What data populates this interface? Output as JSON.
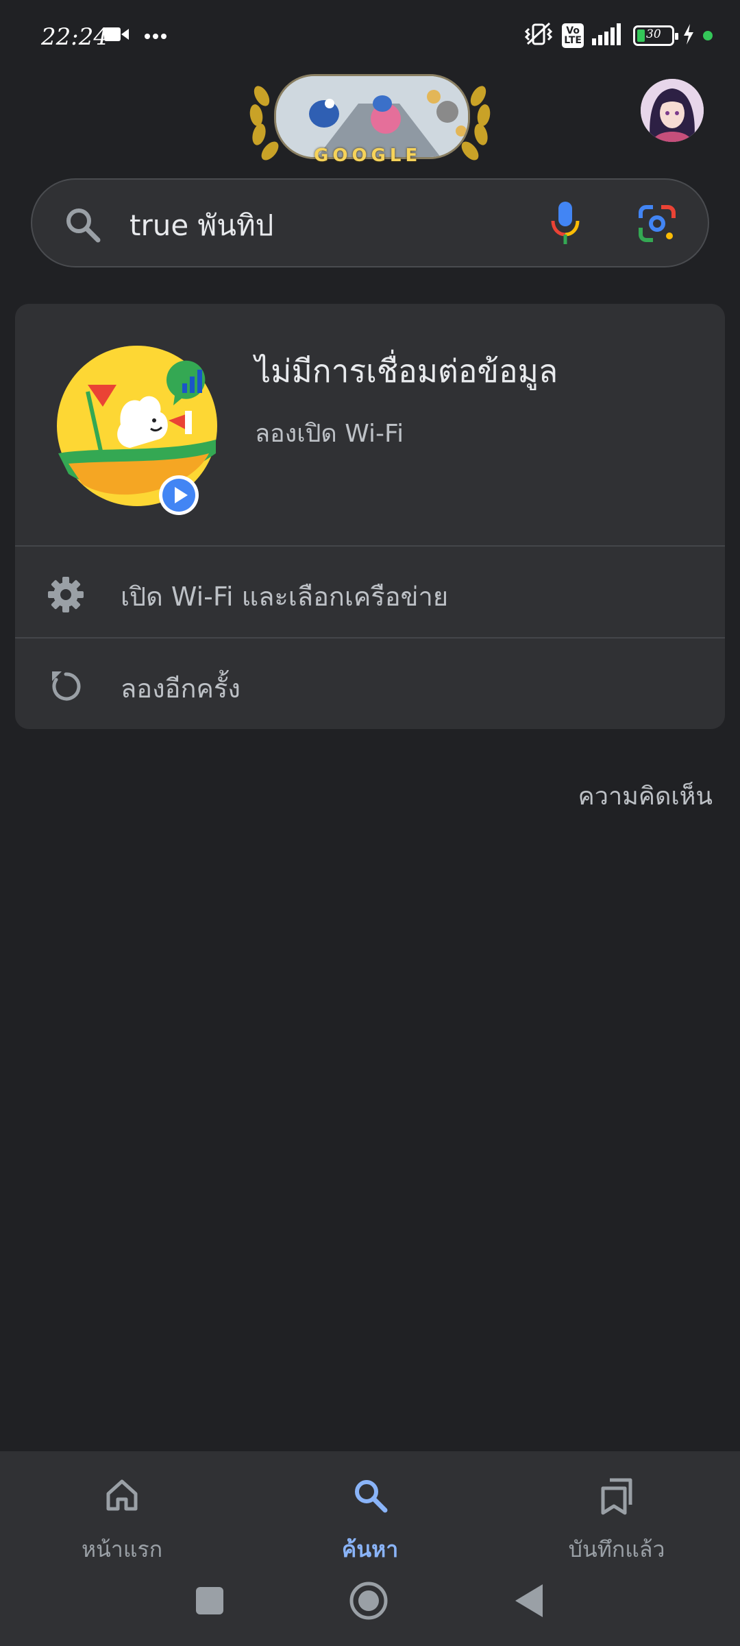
{
  "status_bar": {
    "time": "22:24",
    "battery_level": "30",
    "left_icons": [
      "video-camera-icon",
      "more-dots-icon"
    ],
    "right_icons": [
      "vibrate-off-icon",
      "volte-icon",
      "signal-icon",
      "battery-icon",
      "charging-bolt-icon",
      "green-dot-icon"
    ],
    "volte_top": "Vo",
    "volte_bottom": "LTE"
  },
  "doodle": {
    "label": "GOOGLE"
  },
  "search": {
    "query": "true พันทิป",
    "icons": [
      "search-icon",
      "mic-icon",
      "google-lens-icon"
    ]
  },
  "offline_card": {
    "title": "ไม่มีการเชื่อมต่อข้อมูล",
    "subtitle": "ลองเปิด Wi-Fi",
    "actions": [
      {
        "label": "เปิด Wi-Fi และเลือกเครือข่าย",
        "icon": "gear-icon"
      },
      {
        "label": "ลองอีกครั้ง",
        "icon": "retry-icon"
      }
    ]
  },
  "feedback": {
    "label": "ความคิดเห็น"
  },
  "bottom_nav": {
    "items": [
      {
        "label": "หน้าแรก",
        "icon": "home-icon",
        "active": false
      },
      {
        "label": "ค้นหา",
        "icon": "search-icon",
        "active": true
      },
      {
        "label": "บันทึกแล้ว",
        "icon": "bookmarks-icon",
        "active": false
      }
    ]
  },
  "colors": {
    "background": "#202124",
    "surface": "#303134",
    "accent_blue": "#8ab4f8",
    "text_primary": "#e8eaed",
    "text_secondary": "#bdc1c6"
  }
}
